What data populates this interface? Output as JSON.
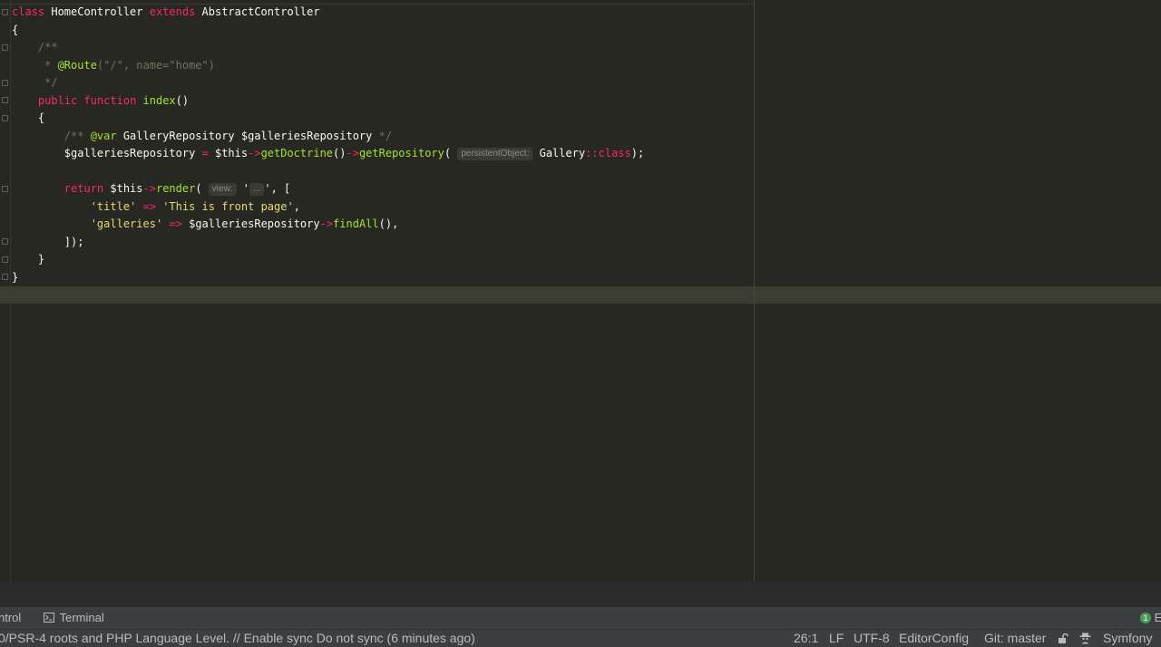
{
  "code_lines": [
    [
      {
        "t": "class",
        "c": "kw"
      },
      {
        "t": " HomeController "
      },
      {
        "t": "extends",
        "c": "kw"
      },
      {
        "t": " AbstractController"
      }
    ],
    [
      {
        "t": "{"
      }
    ],
    [
      {
        "t": "    /**",
        "c": "cm"
      }
    ],
    [
      {
        "t": "     * ",
        "c": "cm"
      },
      {
        "t": "@Route",
        "c": "tag"
      },
      {
        "t": "(\"/\", name=\"home\")",
        "c": "cm"
      }
    ],
    [
      {
        "t": "     */",
        "c": "cm"
      }
    ],
    [
      {
        "t": "    "
      },
      {
        "t": "public",
        "c": "kw"
      },
      {
        "t": " "
      },
      {
        "t": "function",
        "c": "kw"
      },
      {
        "t": " "
      },
      {
        "t": "index",
        "c": "fn"
      },
      {
        "t": "()"
      }
    ],
    [
      {
        "t": "    {"
      }
    ],
    [
      {
        "t": "        /** ",
        "c": "cm"
      },
      {
        "t": "@var",
        "c": "tag"
      },
      {
        "t": " GalleryRepository $galleriesRepository "
      },
      {
        "t": "*/",
        "c": "cm"
      }
    ],
    [
      {
        "t": "        $galleriesRepository "
      },
      {
        "t": "=",
        "c": "op"
      },
      {
        "t": " $this"
      },
      {
        "t": "->",
        "c": "op"
      },
      {
        "t": "getDoctrine",
        "c": "fn"
      },
      {
        "t": "()"
      },
      {
        "t": "->",
        "c": "op"
      },
      {
        "t": "getRepository",
        "c": "fn"
      },
      {
        "t": "( "
      },
      {
        "t": "persistentObject:",
        "c": "hint"
      },
      {
        "t": " Gallery"
      },
      {
        "t": "::",
        "c": "op"
      },
      {
        "t": "class",
        "c": "kw"
      },
      {
        "t": ");"
      }
    ],
    [
      {
        "t": ""
      }
    ],
    [
      {
        "t": "        "
      },
      {
        "t": "return",
        "c": "kw"
      },
      {
        "t": " $this"
      },
      {
        "t": "->",
        "c": "op"
      },
      {
        "t": "render",
        "c": "fn"
      },
      {
        "t": "( "
      },
      {
        "t": "view:",
        "c": "hint"
      },
      {
        "t": " '"
      },
      {
        "t": "...",
        "c": "hint"
      },
      {
        "t": "', ["
      }
    ],
    [
      {
        "t": "            "
      },
      {
        "t": "'title'",
        "c": "str"
      },
      {
        "t": " "
      },
      {
        "t": "=>",
        "c": "op"
      },
      {
        "t": " "
      },
      {
        "t": "'This is front page'",
        "c": "str"
      },
      {
        "t": ","
      }
    ],
    [
      {
        "t": "            "
      },
      {
        "t": "'galleries'",
        "c": "str"
      },
      {
        "t": " "
      },
      {
        "t": "=>",
        "c": "op"
      },
      {
        "t": " $galleriesRepository"
      },
      {
        "t": "->",
        "c": "op"
      },
      {
        "t": "findAll",
        "c": "fn"
      },
      {
        "t": "(),"
      }
    ],
    [
      {
        "t": "        ]);"
      }
    ],
    [
      {
        "t": "    }"
      }
    ],
    [
      {
        "t": "}"
      }
    ]
  ],
  "toolwindow_bar": {
    "version_control_label": "ntrol",
    "terminal_label": "Terminal",
    "event_log_count": "1",
    "event_log_label": "E"
  },
  "status_bar": {
    "message": "0/PSR-4 roots and PHP Language Level. // Enable sync   Do not sync (6 minutes ago)",
    "position": "26:1",
    "line_separator": "LF",
    "encoding": "UTF-8",
    "editorconfig": "EditorConfig",
    "git_branch": "Git: master",
    "framework": "Symfony"
  }
}
